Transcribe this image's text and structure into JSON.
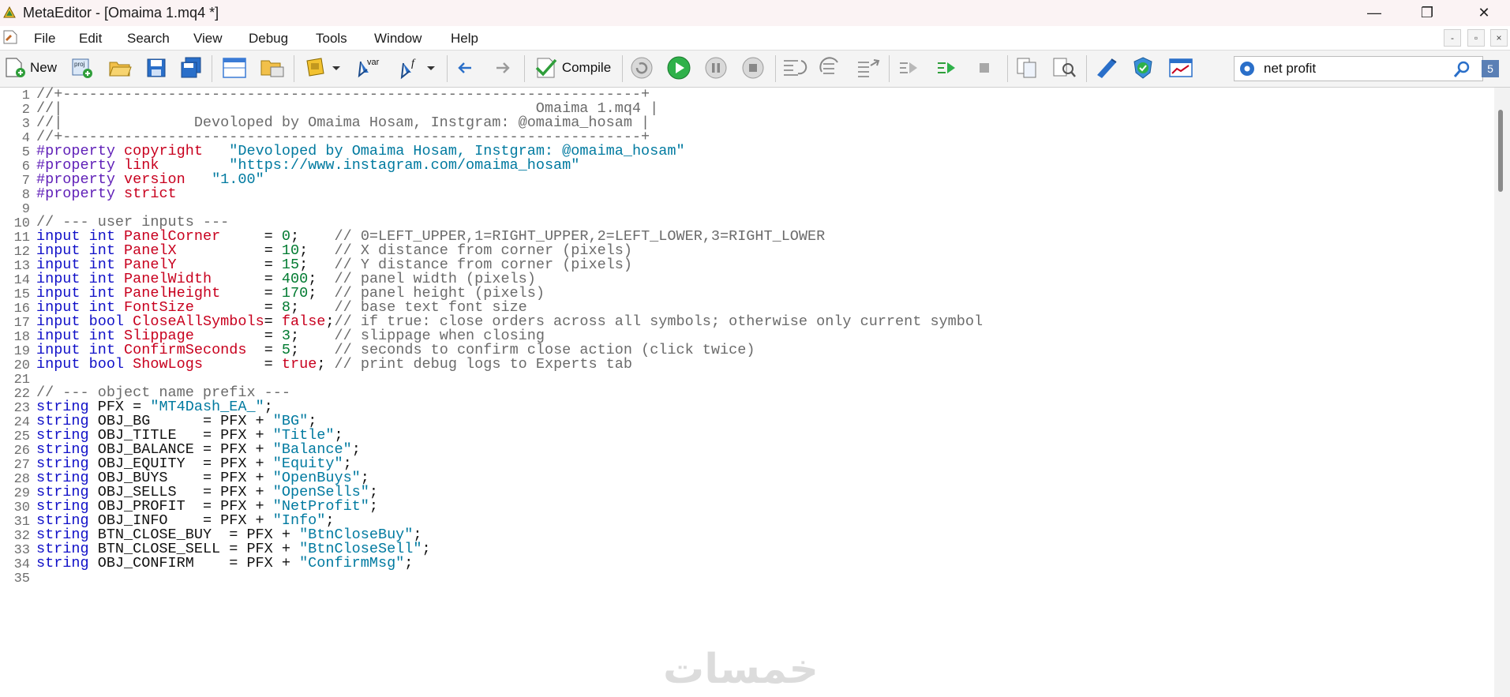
{
  "window": {
    "title": "MetaEditor - [Omaima 1.mq4 *]",
    "controls": [
      "—",
      "❐",
      "✕"
    ]
  },
  "menu": [
    "File",
    "Edit",
    "Search",
    "View",
    "Debug",
    "Tools",
    "Window",
    "Help"
  ],
  "mdi_controls": [
    "-",
    "▫",
    "×"
  ],
  "toolbar": {
    "new_label": "New",
    "compile_label": "Compile",
    "var_label": "var"
  },
  "search": {
    "value": "net profit",
    "badge": "5"
  },
  "watermark": "خمسات",
  "colors": {
    "keyword": "#1010c8",
    "preprocessor": "#6020b8",
    "identifier": "#c8001e",
    "string": "#007aa0",
    "number": "#007a30",
    "comment": "#6b6b6b"
  },
  "editor": {
    "lines": [
      [
        [
          "com",
          "//+------------------------------------------------------------------+"
        ]
      ],
      [
        [
          "com",
          "//|                                                      Omaima 1.mq4 |"
        ]
      ],
      [
        [
          "com",
          "//|               Devoloped by Omaima Hosam, Instgram: @omaima_hosam |"
        ]
      ],
      [
        [
          "com",
          "//+------------------------------------------------------------------+"
        ]
      ],
      [
        [
          "pp",
          "#property "
        ],
        [
          "id",
          "copyright"
        ],
        [
          "pl",
          "   "
        ],
        [
          "str",
          "\"Devoloped by Omaima Hosam, Instgram: @omaima_hosam\""
        ]
      ],
      [
        [
          "pp",
          "#property "
        ],
        [
          "id",
          "link"
        ],
        [
          "pl",
          "        "
        ],
        [
          "str",
          "\"https://www.instagram.com/omaima_hosam\""
        ]
      ],
      [
        [
          "pp",
          "#property "
        ],
        [
          "id",
          "version"
        ],
        [
          "pl",
          "   "
        ],
        [
          "str",
          "\"1.00\""
        ]
      ],
      [
        [
          "pp",
          "#property "
        ],
        [
          "id",
          "strict"
        ]
      ],
      [],
      [
        [
          "com",
          "// --- user inputs ---"
        ]
      ],
      [
        [
          "kw",
          "input "
        ],
        [
          "kw",
          "int "
        ],
        [
          "id",
          "PanelCorner"
        ],
        [
          "pl",
          "     = "
        ],
        [
          "num",
          "0"
        ],
        [
          "pl",
          ";    "
        ],
        [
          "com",
          "// 0=LEFT_UPPER,1=RIGHT_UPPER,2=LEFT_LOWER,3=RIGHT_LOWER"
        ]
      ],
      [
        [
          "kw",
          "input "
        ],
        [
          "kw",
          "int "
        ],
        [
          "id",
          "PanelX"
        ],
        [
          "pl",
          "          = "
        ],
        [
          "num",
          "10"
        ],
        [
          "pl",
          ";   "
        ],
        [
          "com",
          "// X distance from corner (pixels)"
        ]
      ],
      [
        [
          "kw",
          "input "
        ],
        [
          "kw",
          "int "
        ],
        [
          "id",
          "PanelY"
        ],
        [
          "pl",
          "          = "
        ],
        [
          "num",
          "15"
        ],
        [
          "pl",
          ";   "
        ],
        [
          "com",
          "// Y distance from corner (pixels)"
        ]
      ],
      [
        [
          "kw",
          "input "
        ],
        [
          "kw",
          "int "
        ],
        [
          "id",
          "PanelWidth"
        ],
        [
          "pl",
          "      = "
        ],
        [
          "num",
          "400"
        ],
        [
          "pl",
          ";  "
        ],
        [
          "com",
          "// panel width (pixels)"
        ]
      ],
      [
        [
          "kw",
          "input "
        ],
        [
          "kw",
          "int "
        ],
        [
          "id",
          "PanelHeight"
        ],
        [
          "pl",
          "     = "
        ],
        [
          "num",
          "170"
        ],
        [
          "pl",
          ";  "
        ],
        [
          "com",
          "// panel height (pixels)"
        ]
      ],
      [
        [
          "kw",
          "input "
        ],
        [
          "kw",
          "int "
        ],
        [
          "id",
          "FontSize"
        ],
        [
          "pl",
          "        = "
        ],
        [
          "num",
          "8"
        ],
        [
          "pl",
          ";    "
        ],
        [
          "com",
          "// base text font size"
        ]
      ],
      [
        [
          "kw",
          "input "
        ],
        [
          "kw",
          "bool "
        ],
        [
          "id",
          "CloseAllSymbols"
        ],
        [
          "pl",
          "= "
        ],
        [
          "id",
          "false"
        ],
        [
          "pl",
          ";"
        ],
        [
          "com",
          "// if true: close orders across all symbols; otherwise only current symbol"
        ]
      ],
      [
        [
          "kw",
          "input "
        ],
        [
          "kw",
          "int "
        ],
        [
          "id",
          "Slippage"
        ],
        [
          "pl",
          "        = "
        ],
        [
          "num",
          "3"
        ],
        [
          "pl",
          ";    "
        ],
        [
          "com",
          "// slippage when closing"
        ]
      ],
      [
        [
          "kw",
          "input "
        ],
        [
          "kw",
          "int "
        ],
        [
          "id",
          "ConfirmSeconds"
        ],
        [
          "pl",
          "  = "
        ],
        [
          "num",
          "5"
        ],
        [
          "pl",
          ";    "
        ],
        [
          "com",
          "// seconds to confirm close action (click twice)"
        ]
      ],
      [
        [
          "kw",
          "input "
        ],
        [
          "kw",
          "bool "
        ],
        [
          "id",
          "ShowLogs"
        ],
        [
          "pl",
          "       = "
        ],
        [
          "id",
          "true"
        ],
        [
          "pl",
          "; "
        ],
        [
          "com",
          "// print debug logs to Experts tab"
        ]
      ],
      [],
      [
        [
          "com",
          "// --- object name prefix ---"
        ]
      ],
      [
        [
          "kw",
          "string "
        ],
        [
          "pl",
          "PFX = "
        ],
        [
          "str",
          "\"MT4Dash_EA_\""
        ],
        [
          "pl",
          ";"
        ]
      ],
      [
        [
          "kw",
          "string "
        ],
        [
          "pl",
          "OBJ_BG      = PFX + "
        ],
        [
          "str",
          "\"BG\""
        ],
        [
          "pl",
          ";"
        ]
      ],
      [
        [
          "kw",
          "string "
        ],
        [
          "pl",
          "OBJ_TITLE   = PFX + "
        ],
        [
          "str",
          "\"Title\""
        ],
        [
          "pl",
          ";"
        ]
      ],
      [
        [
          "kw",
          "string "
        ],
        [
          "pl",
          "OBJ_BALANCE = PFX + "
        ],
        [
          "str",
          "\"Balance\""
        ],
        [
          "pl",
          ";"
        ]
      ],
      [
        [
          "kw",
          "string "
        ],
        [
          "pl",
          "OBJ_EQUITY  = PFX + "
        ],
        [
          "str",
          "\"Equity\""
        ],
        [
          "pl",
          ";"
        ]
      ],
      [
        [
          "kw",
          "string "
        ],
        [
          "pl",
          "OBJ_BUYS    = PFX + "
        ],
        [
          "str",
          "\"OpenBuys\""
        ],
        [
          "pl",
          ";"
        ]
      ],
      [
        [
          "kw",
          "string "
        ],
        [
          "pl",
          "OBJ_SELLS   = PFX + "
        ],
        [
          "str",
          "\"OpenSells\""
        ],
        [
          "pl",
          ";"
        ]
      ],
      [
        [
          "kw",
          "string "
        ],
        [
          "pl",
          "OBJ_PROFIT  = PFX + "
        ],
        [
          "str",
          "\"NetProfit\""
        ],
        [
          "pl",
          ";"
        ]
      ],
      [
        [
          "kw",
          "string "
        ],
        [
          "pl",
          "OBJ_INFO    = PFX + "
        ],
        [
          "str",
          "\"Info\""
        ],
        [
          "pl",
          ";"
        ]
      ],
      [
        [
          "kw",
          "string "
        ],
        [
          "pl",
          "BTN_CLOSE_BUY  = PFX + "
        ],
        [
          "str",
          "\"BtnCloseBuy\""
        ],
        [
          "pl",
          ";"
        ]
      ],
      [
        [
          "kw",
          "string "
        ],
        [
          "pl",
          "BTN_CLOSE_SELL = PFX + "
        ],
        [
          "str",
          "\"BtnCloseSell\""
        ],
        [
          "pl",
          ";"
        ]
      ],
      [
        [
          "kw",
          "string "
        ],
        [
          "pl",
          "OBJ_CONFIRM    = PFX + "
        ],
        [
          "str",
          "\"ConfirmMsg\""
        ],
        [
          "pl",
          ";"
        ]
      ],
      []
    ]
  }
}
